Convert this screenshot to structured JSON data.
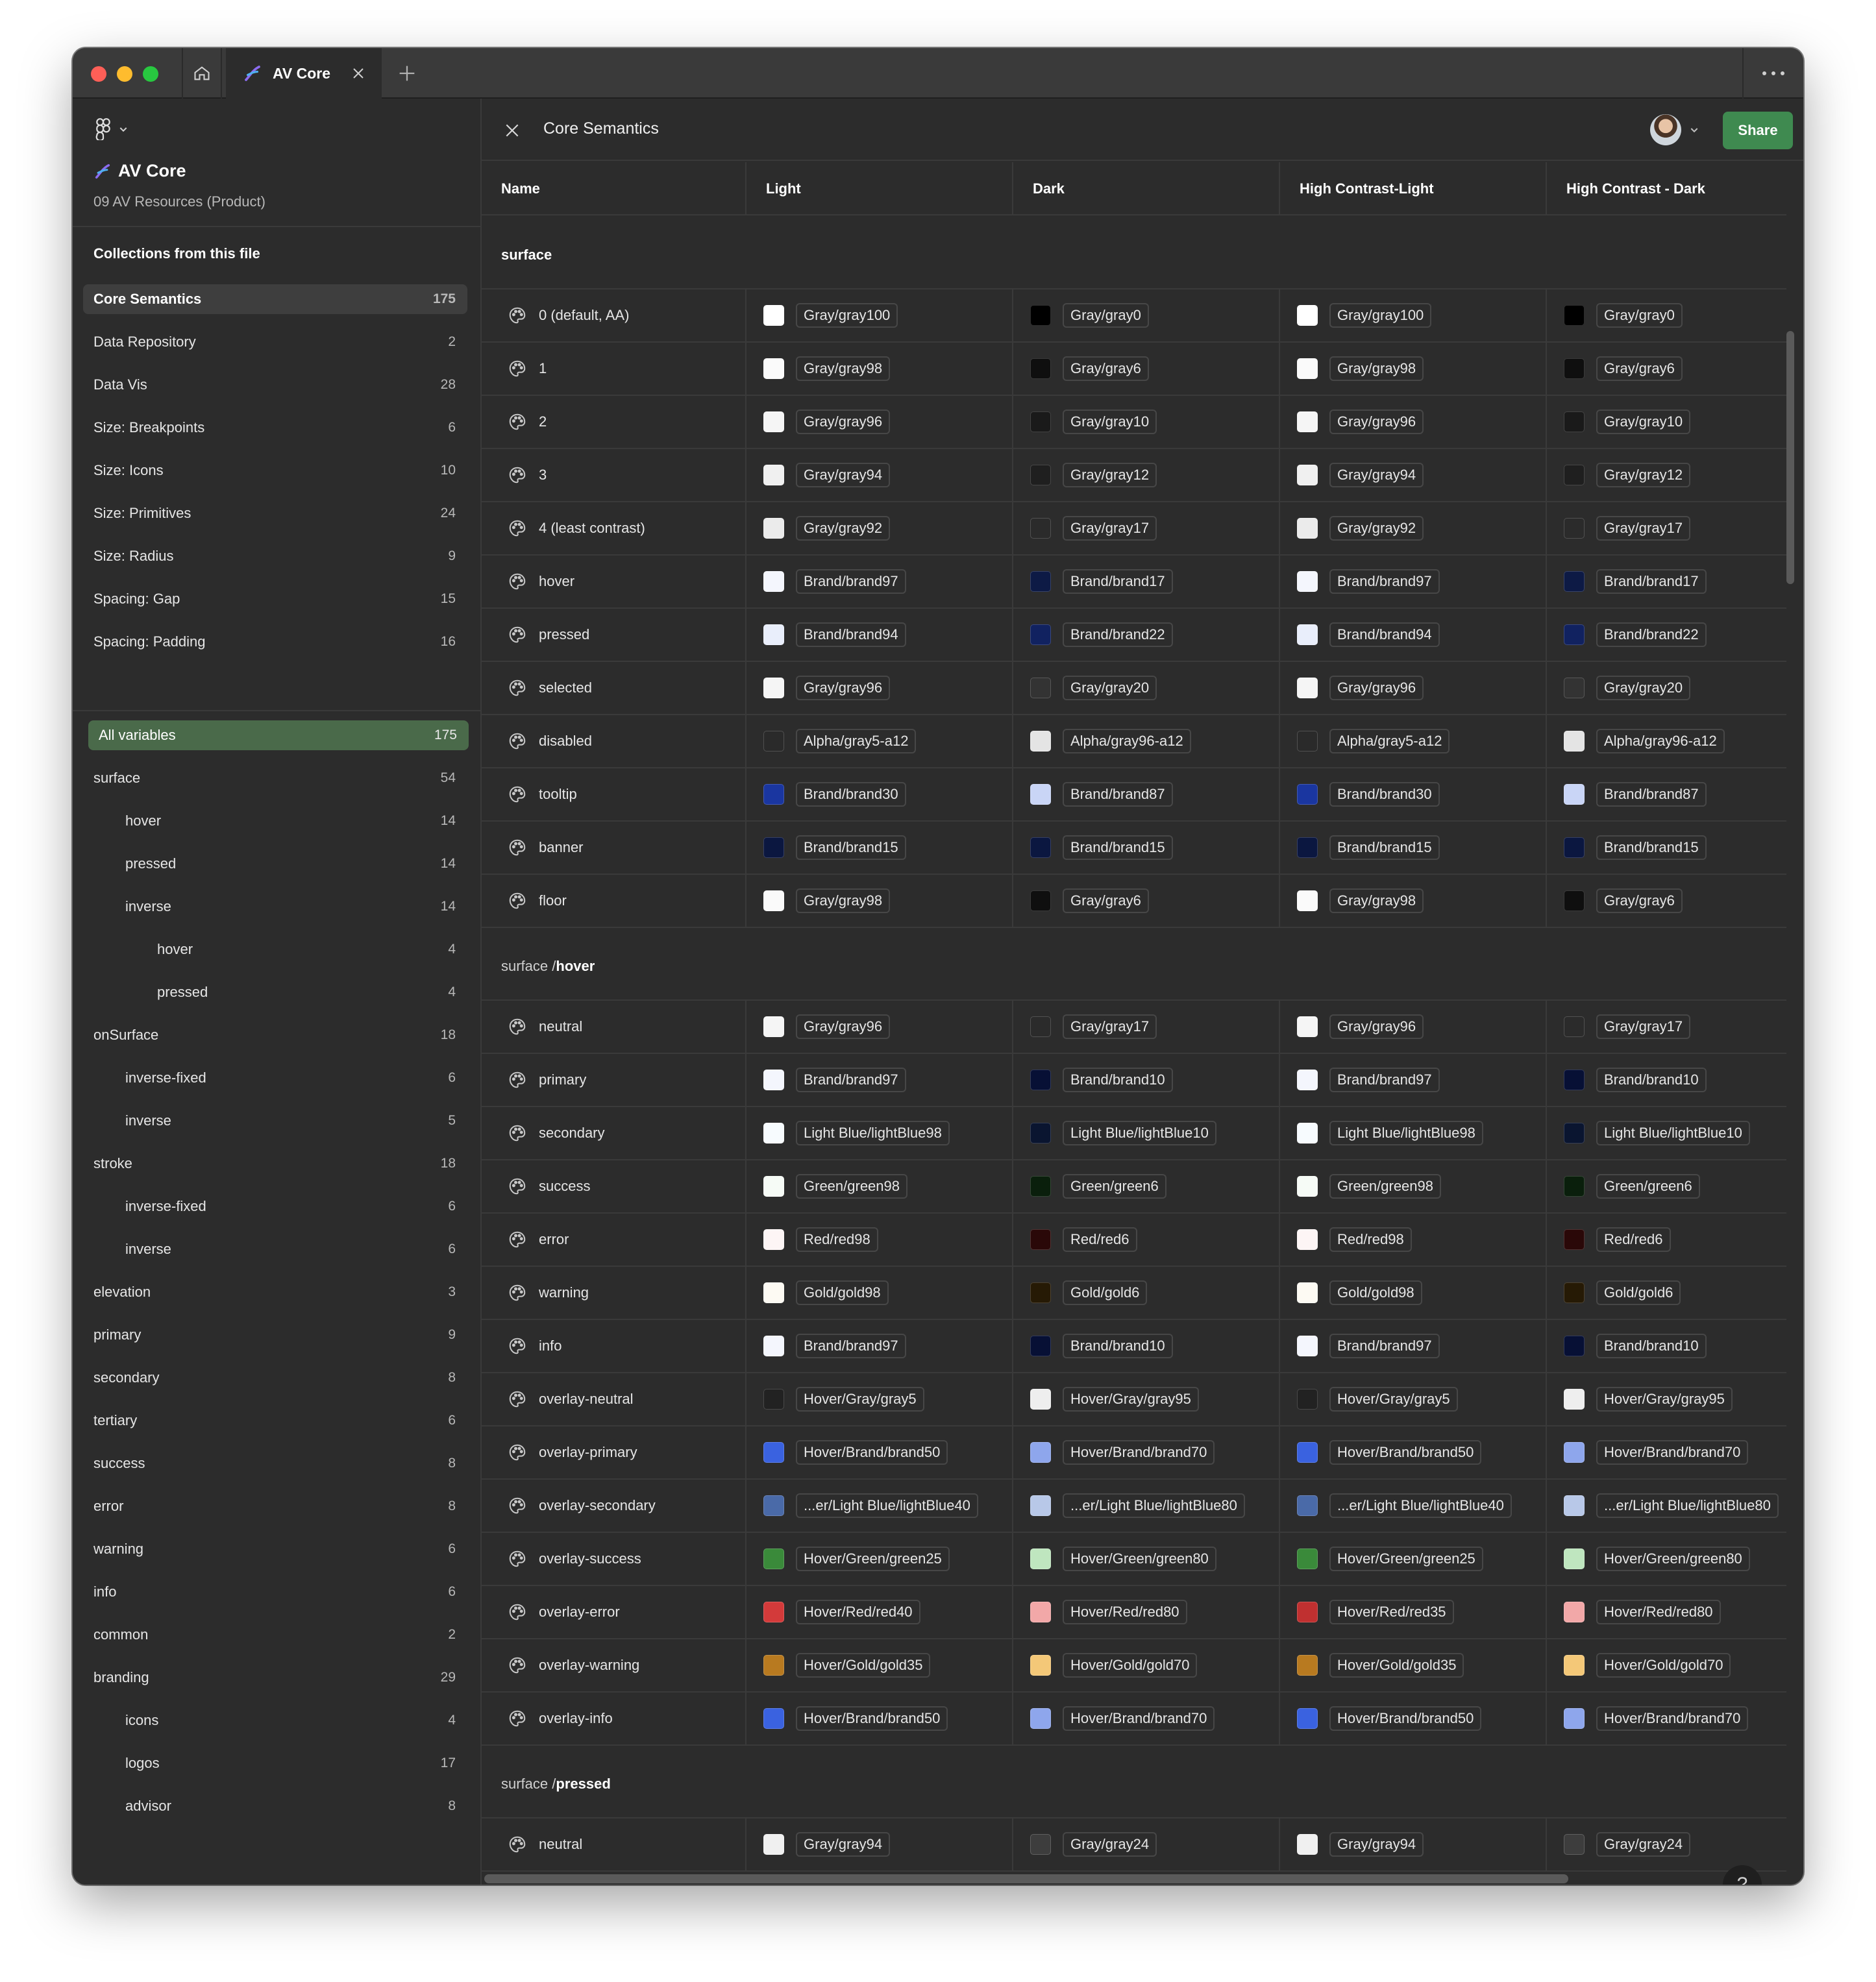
{
  "window": {
    "tab_title": "AV Core"
  },
  "sidebar": {
    "file_name": "AV Core",
    "file_subtitle": "09 AV Resources (Product)",
    "collections_heading": "Collections from this file",
    "collections": [
      {
        "label": "Core Semantics",
        "count": "175"
      },
      {
        "label": "Data Repository",
        "count": "2"
      },
      {
        "label": "Data Vis",
        "count": "28"
      },
      {
        "label": "Size: Breakpoints",
        "count": "6"
      },
      {
        "label": "Size: Icons",
        "count": "10"
      },
      {
        "label": "Size: Primitives",
        "count": "24"
      },
      {
        "label": "Size: Radius",
        "count": "9"
      },
      {
        "label": "Spacing: Gap",
        "count": "15"
      },
      {
        "label": "Spacing: Padding",
        "count": "16"
      }
    ],
    "groups": [
      {
        "label": "All variables",
        "count": "175",
        "level": 0
      },
      {
        "label": "surface",
        "count": "54",
        "level": 0
      },
      {
        "label": "hover",
        "count": "14",
        "level": 1
      },
      {
        "label": "pressed",
        "count": "14",
        "level": 1
      },
      {
        "label": "inverse",
        "count": "14",
        "level": 1
      },
      {
        "label": "hover",
        "count": "4",
        "level": 2
      },
      {
        "label": "pressed",
        "count": "4",
        "level": 2
      },
      {
        "label": "onSurface",
        "count": "18",
        "level": 0
      },
      {
        "label": "inverse-fixed",
        "count": "6",
        "level": 1
      },
      {
        "label": "inverse",
        "count": "5",
        "level": 1
      },
      {
        "label": "stroke",
        "count": "18",
        "level": 0
      },
      {
        "label": "inverse-fixed",
        "count": "6",
        "level": 1
      },
      {
        "label": "inverse",
        "count": "6",
        "level": 1
      },
      {
        "label": "elevation",
        "count": "3",
        "level": 0
      },
      {
        "label": "primary",
        "count": "9",
        "level": 0
      },
      {
        "label": "secondary",
        "count": "8",
        "level": 0
      },
      {
        "label": "tertiary",
        "count": "6",
        "level": 0
      },
      {
        "label": "success",
        "count": "8",
        "level": 0
      },
      {
        "label": "error",
        "count": "8",
        "level": 0
      },
      {
        "label": "warning",
        "count": "6",
        "level": 0
      },
      {
        "label": "info",
        "count": "6",
        "level": 0
      },
      {
        "label": "common",
        "count": "2",
        "level": 0
      },
      {
        "label": "branding",
        "count": "29",
        "level": 0
      },
      {
        "label": "icons",
        "count": "4",
        "level": 1
      },
      {
        "label": "logos",
        "count": "17",
        "level": 1
      },
      {
        "label": "advisor",
        "count": "8",
        "level": 1
      }
    ]
  },
  "header": {
    "collection_title": "Core Semantics",
    "share_label": "Share",
    "help_label": "?"
  },
  "table": {
    "columns": [
      "Name",
      "Light",
      "Dark",
      "High Contrast-Light",
      "High Contrast - Dark"
    ],
    "groups": [
      {
        "prefix": "",
        "suffix": "surface",
        "rows": [
          {
            "name": "0 (default, AA)",
            "values": [
              [
                "Gray/gray100",
                "#ffffff"
              ],
              [
                "Gray/gray0",
                "#000000"
              ],
              [
                "Gray/gray100",
                "#ffffff"
              ],
              [
                "Gray/gray0",
                "#000000"
              ]
            ]
          },
          {
            "name": "1",
            "values": [
              [
                "Gray/gray98",
                "#fafafa"
              ],
              [
                "Gray/gray6",
                "#0f0f0f"
              ],
              [
                "Gray/gray98",
                "#fafafa"
              ],
              [
                "Gray/gray6",
                "#0f0f0f"
              ]
            ]
          },
          {
            "name": "2",
            "values": [
              [
                "Gray/gray96",
                "#f5f5f5"
              ],
              [
                "Gray/gray10",
                "#1a1a1a"
              ],
              [
                "Gray/gray96",
                "#f5f5f5"
              ],
              [
                "Gray/gray10",
                "#1a1a1a"
              ]
            ]
          },
          {
            "name": "3",
            "values": [
              [
                "Gray/gray94",
                "#f0f0f0"
              ],
              [
                "Gray/gray12",
                "#1f1f1f"
              ],
              [
                "Gray/gray94",
                "#f0f0f0"
              ],
              [
                "Gray/gray12",
                "#1f1f1f"
              ]
            ]
          },
          {
            "name": "4 (least contrast)",
            "values": [
              [
                "Gray/gray92",
                "#ebebeb"
              ],
              [
                "Gray/gray17",
                "#2b2b2b"
              ],
              [
                "Gray/gray92",
                "#ebebeb"
              ],
              [
                "Gray/gray17",
                "#2b2b2b"
              ]
            ]
          },
          {
            "name": "hover",
            "values": [
              [
                "Brand/brand97",
                "#f4f6fd"
              ],
              [
                "Brand/brand17",
                "#0d1a45"
              ],
              [
                "Brand/brand97",
                "#f4f6fd"
              ],
              [
                "Brand/brand17",
                "#0d1a45"
              ]
            ]
          },
          {
            "name": "pressed",
            "values": [
              [
                "Brand/brand94",
                "#e9eefb"
              ],
              [
                "Brand/brand22",
                "#112260"
              ],
              [
                "Brand/brand94",
                "#e9eefb"
              ],
              [
                "Brand/brand22",
                "#112260"
              ]
            ]
          },
          {
            "name": "selected",
            "values": [
              [
                "Gray/gray96",
                "#f5f5f5"
              ],
              [
                "Gray/gray20",
                "#333333"
              ],
              [
                "Gray/gray96",
                "#f5f5f5"
              ],
              [
                "Gray/gray20",
                "#333333"
              ]
            ]
          },
          {
            "name": "disabled",
            "values": [
              [
                "Alpha/gray5-a12",
                "#2a2a2a"
              ],
              [
                "Alpha/gray96-a12",
                "#e4e4e4"
              ],
              [
                "Alpha/gray5-a12",
                "#2a2a2a"
              ],
              [
                "Alpha/gray96-a12",
                "#e4e4e4"
              ]
            ]
          },
          {
            "name": "tooltip",
            "values": [
              [
                "Brand/brand30",
                "#1a36a0"
              ],
              [
                "Brand/brand87",
                "#c9d5f6"
              ],
              [
                "Brand/brand30",
                "#1a36a0"
              ],
              [
                "Brand/brand87",
                "#c9d5f6"
              ]
            ]
          },
          {
            "name": "banner",
            "values": [
              [
                "Brand/brand15",
                "#0b1740"
              ],
              [
                "Brand/brand15",
                "#0b1740"
              ],
              [
                "Brand/brand15",
                "#0b1740"
              ],
              [
                "Brand/brand15",
                "#0b1740"
              ]
            ]
          },
          {
            "name": "floor",
            "values": [
              [
                "Gray/gray98",
                "#fafafa"
              ],
              [
                "Gray/gray6",
                "#0f0f0f"
              ],
              [
                "Gray/gray98",
                "#fafafa"
              ],
              [
                "Gray/gray6",
                "#0f0f0f"
              ]
            ]
          }
        ]
      },
      {
        "prefix": "surface / ",
        "suffix": "hover",
        "rows": [
          {
            "name": "neutral",
            "values": [
              [
                "Gray/gray96",
                "#f5f5f5"
              ],
              [
                "Gray/gray17",
                "#2b2b2b"
              ],
              [
                "Gray/gray96",
                "#f5f5f5"
              ],
              [
                "Gray/gray17",
                "#2b2b2b"
              ]
            ]
          },
          {
            "name": "primary",
            "values": [
              [
                "Brand/brand97",
                "#f4f6fd"
              ],
              [
                "Brand/brand10",
                "#071035"
              ],
              [
                "Brand/brand97",
                "#f4f6fd"
              ],
              [
                "Brand/brand10",
                "#071035"
              ]
            ]
          },
          {
            "name": "secondary",
            "values": [
              [
                "Light Blue/lightBlue98",
                "#f7fbfe"
              ],
              [
                "Light Blue/lightBlue10",
                "#0a1530"
              ],
              [
                "Light Blue/lightBlue98",
                "#f7fbfe"
              ],
              [
                "Light Blue/lightBlue10",
                "#0a1530"
              ]
            ]
          },
          {
            "name": "success",
            "values": [
              [
                "Green/green98",
                "#f6fbf6"
              ],
              [
                "Green/green6",
                "#0a1f0c"
              ],
              [
                "Green/green98",
                "#f6fbf6"
              ],
              [
                "Green/green6",
                "#0a1f0c"
              ]
            ]
          },
          {
            "name": "error",
            "values": [
              [
                "Red/red98",
                "#fdf5f5"
              ],
              [
                "Red/red6",
                "#2a0808"
              ],
              [
                "Red/red98",
                "#fdf5f5"
              ],
              [
                "Red/red6",
                "#2a0808"
              ]
            ]
          },
          {
            "name": "warning",
            "values": [
              [
                "Gold/gold98",
                "#fdfaf3"
              ],
              [
                "Gold/gold6",
                "#261a05"
              ],
              [
                "Gold/gold98",
                "#fdfaf3"
              ],
              [
                "Gold/gold6",
                "#261a05"
              ]
            ]
          },
          {
            "name": "info",
            "values": [
              [
                "Brand/brand97",
                "#f4f6fd"
              ],
              [
                "Brand/brand10",
                "#071035"
              ],
              [
                "Brand/brand97",
                "#f4f6fd"
              ],
              [
                "Brand/brand10",
                "#071035"
              ]
            ]
          },
          {
            "name": "overlay-neutral",
            "values": [
              [
                "Hover/Gray/gray5",
                "#222222"
              ],
              [
                "Hover/Gray/gray95",
                "#eeeeee"
              ],
              [
                "Hover/Gray/gray5",
                "#222222"
              ],
              [
                "Hover/Gray/gray95",
                "#eeeeee"
              ]
            ]
          },
          {
            "name": "overlay-primary",
            "values": [
              [
                "Hover/Brand/brand50",
                "#3a62e0"
              ],
              [
                "Hover/Brand/brand70",
                "#8ea6ec"
              ],
              [
                "Hover/Brand/brand50",
                "#3a62e0"
              ],
              [
                "Hover/Brand/brand70",
                "#8ea6ec"
              ]
            ]
          },
          {
            "name": "overlay-secondary",
            "values": [
              [
                "...er/Light Blue/lightBlue40",
                "#4a6aa8"
              ],
              [
                "...er/Light Blue/lightBlue80",
                "#b8c8e8"
              ],
              [
                "...er/Light Blue/lightBlue40",
                "#4a6aa8"
              ],
              [
                "...er/Light Blue/lightBlue80",
                "#b8c8e8"
              ]
            ]
          },
          {
            "name": "overlay-success",
            "values": [
              [
                "Hover/Green/green25",
                "#3a8a3a"
              ],
              [
                "Hover/Green/green80",
                "#bfe6bf"
              ],
              [
                "Hover/Green/green25",
                "#3a8a3a"
              ],
              [
                "Hover/Green/green80",
                "#bfe6bf"
              ]
            ]
          },
          {
            "name": "overlay-error",
            "values": [
              [
                "Hover/Red/red40",
                "#d33a3a"
              ],
              [
                "Hover/Red/red80",
                "#f2a8a8"
              ],
              [
                "Hover/Red/red35",
                "#c03030"
              ],
              [
                "Hover/Red/red80",
                "#f2a8a8"
              ]
            ]
          },
          {
            "name": "overlay-warning",
            "values": [
              [
                "Hover/Gold/gold35",
                "#b87a20"
              ],
              [
                "Hover/Gold/gold70",
                "#f4c878"
              ],
              [
                "Hover/Gold/gold35",
                "#b87a20"
              ],
              [
                "Hover/Gold/gold70",
                "#f4c878"
              ]
            ]
          },
          {
            "name": "overlay-info",
            "values": [
              [
                "Hover/Brand/brand50",
                "#3a62e0"
              ],
              [
                "Hover/Brand/brand70",
                "#8ea6ec"
              ],
              [
                "Hover/Brand/brand50",
                "#3a62e0"
              ],
              [
                "Hover/Brand/brand70",
                "#8ea6ec"
              ]
            ]
          }
        ]
      },
      {
        "prefix": "surface / ",
        "suffix": "pressed",
        "rows": [
          {
            "name": "neutral",
            "values": [
              [
                "Gray/gray94",
                "#f0f0f0"
              ],
              [
                "Gray/gray24",
                "#3d3d3d"
              ],
              [
                "Gray/gray94",
                "#f0f0f0"
              ],
              [
                "Gray/gray24",
                "#3d3d3d"
              ]
            ]
          }
        ]
      }
    ]
  }
}
